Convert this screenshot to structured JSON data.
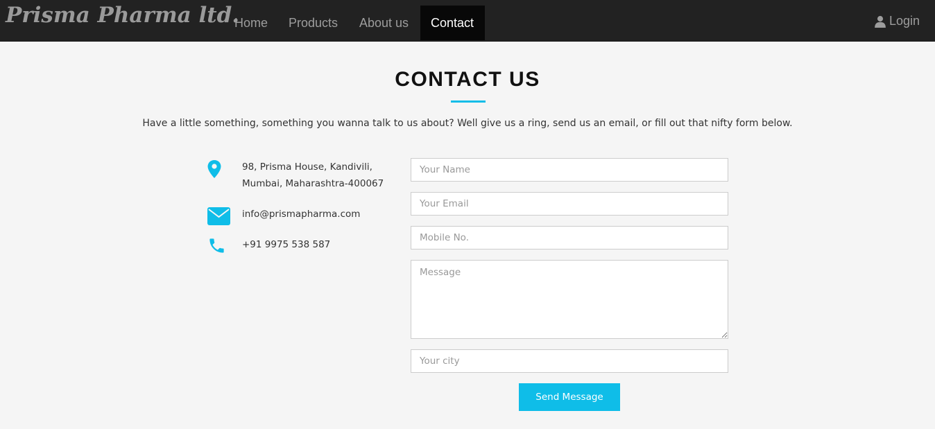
{
  "navbar": {
    "brand": "Prisma Pharma ltd.",
    "items": [
      {
        "label": "Home"
      },
      {
        "label": "Products"
      },
      {
        "label": "About us"
      },
      {
        "label": "Contact",
        "active": true
      }
    ],
    "login": {
      "label": "Login",
      "icon": "user-icon"
    }
  },
  "contact": {
    "title": "CONTACT US",
    "subtitle": "Have a little something, something you wanna talk to us about? Well give us a ring, send us an email, or fill out that nifty form below.",
    "accent_color": "#0fbde8",
    "info": {
      "address_line1": "98, Prisma House, Kandivili,",
      "address_line2": "Mumbai, Maharashtra-400067",
      "email": "info@prismapharma.com",
      "phone": "+91 9975 538 587",
      "icons": [
        "map-pin-icon",
        "envelope-icon",
        "phone-icon"
      ]
    },
    "form": {
      "name_placeholder": "Your Name",
      "name_value": "",
      "email_placeholder": "Your Email",
      "email_value": "",
      "mobile_placeholder": "Mobile No.",
      "mobile_value": "",
      "message_placeholder": "Message",
      "message_value": "",
      "city_placeholder": "Your city",
      "city_value": "",
      "submit_label": "Send Message"
    }
  }
}
